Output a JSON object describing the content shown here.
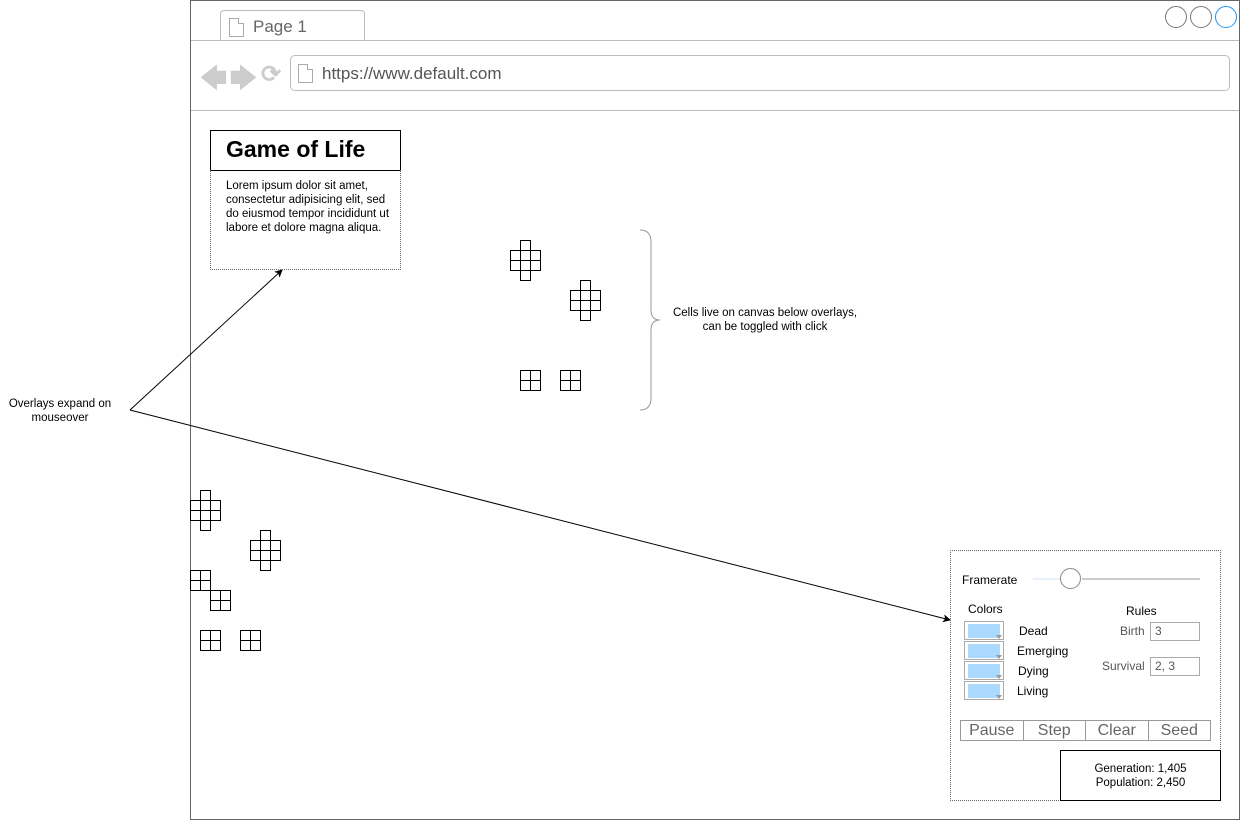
{
  "browser": {
    "tab_label": "Page 1",
    "url": "https://www.default.com",
    "nav_icons": [
      "back-arrow-icon",
      "forward-arrow-icon",
      "reload-icon"
    ],
    "window_controls_accent": "#2196f3"
  },
  "overlay_info": {
    "title": "Game of Life",
    "description": "Lorem ipsum dolor sit amet, consectetur adipisicing elit, sed do eiusmod tempor incididunt ut labore et dolore magna aliqua."
  },
  "annotations": {
    "overlays": "Overlays expand on mouseover",
    "cells": "Cells live on canvas below overlays, can be toggled with click"
  },
  "controls": {
    "framerate_label": "Framerate",
    "framerate_value": 0.18,
    "colors_label": "Colors",
    "colors": [
      {
        "label": "Dead",
        "color": "#aad8fe"
      },
      {
        "label": "Emerging",
        "color": "#aad8fe"
      },
      {
        "label": "Dying",
        "color": "#aad8fe"
      },
      {
        "label": "Living",
        "color": "#aad8fe"
      }
    ],
    "rules_label": "Rules",
    "birth_label": "Birth",
    "birth_value": "3",
    "survival_label": "Survival",
    "survival_value": "2, 3",
    "buttons": [
      "Pause",
      "Step",
      "Clear",
      "Seed"
    ]
  },
  "stats": {
    "generation": "Generation: 1,405",
    "population": "Population: 2,450"
  }
}
